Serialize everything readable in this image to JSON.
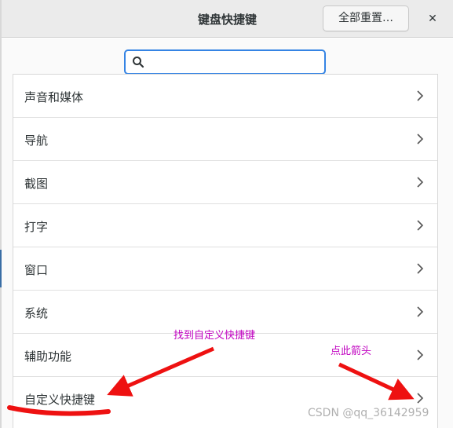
{
  "header": {
    "title": "键盘快捷键",
    "reset_label": "全部重置…",
    "close_glyph": "✕"
  },
  "search": {
    "value": "",
    "placeholder": ""
  },
  "list": {
    "items": [
      {
        "label": "声音和媒体"
      },
      {
        "label": "导航"
      },
      {
        "label": "截图"
      },
      {
        "label": "打字"
      },
      {
        "label": "窗口"
      },
      {
        "label": "系统"
      },
      {
        "label": "辅助功能"
      },
      {
        "label": "自定义快捷键"
      }
    ]
  },
  "annotations": {
    "find_custom": "找到自定义快捷键",
    "click_arrow": "点此箭头",
    "color": "#c000c0",
    "arrow_color": "#ee1111"
  },
  "watermark": "CSDN @qq_36142959",
  "colors": {
    "accent": "#3584e4",
    "headerbar": "#ebebeb"
  },
  "icons": {
    "search": "search-icon",
    "chevron": "chevron-right-icon",
    "close": "close-icon"
  }
}
